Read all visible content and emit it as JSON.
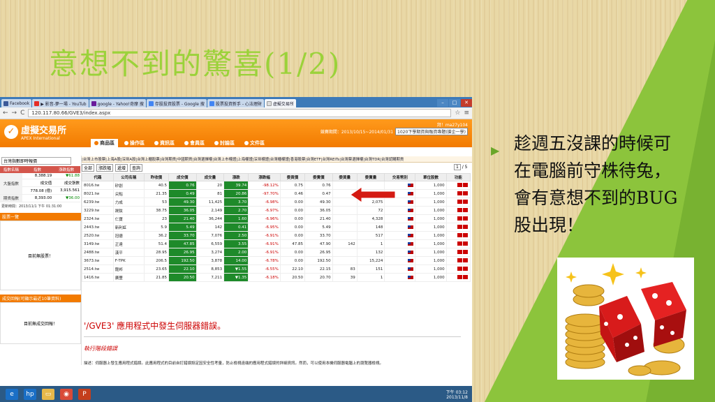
{
  "slide": {
    "title": "意想不到的驚喜(1/2)",
    "bullet": "趁週五沒課的時候可在電腦前守株待兔，會有意想不到的BUG股出現！"
  },
  "browser": {
    "tabs": [
      "Facebook",
      "▶ 影音-夢一場 - YouTub",
      "google - Yahoo!奇摩 搜",
      "存股投資股票 - Google 搜",
      "股票投資新手 - 心法理財",
      "虛擬交易所"
    ],
    "url": "120.117.80.66/GVE3/index.aspx"
  },
  "app": {
    "name": "虛擬交易所",
    "name_en": "APEX International",
    "user": "拜！ma27y104",
    "period": "競賽期間：2013/10/15~2014/01/31",
    "contest": "1020下學期資與融資專題(搶企一學)",
    "nav": [
      "商品區",
      "操作區",
      "資訊區",
      "會員區",
      "討論區",
      "文件區"
    ],
    "subnav": "|台灣上市股票|上海A股|深圳A股|台灣上櫃股票|台灣期貨|中國期貨|台灣選擇權|台灣上市權證|上海權證|深圳權證|台灣櫃權證|香港股票|台灣ETF|台灣REITs|台灣票選擇權|台灣TDR|台灣認購期貨"
  },
  "left": {
    "select": "台灣指數即時報價",
    "headers": [
      "指數名稱",
      "指數",
      "漲跌指數"
    ],
    "rows": [
      {
        "name": "大盤指數",
        "v1": "8,388.19",
        "v2": "▼61.88",
        "v3": "成交值",
        "v4": "成交張數",
        "v5": "778.08 (億)",
        "v6": "3,915.561"
      },
      {
        "name": "期貨指數",
        "v1": "8,393.00",
        "v2": "▼36.00"
      }
    ],
    "updated": "更新時間：2013/11/1 下午 01:31:00",
    "panel1": "股票一覽",
    "panel1_body": "目前無股票！",
    "panel2": "成交回報(可顯示最近10筆資料)",
    "panel2_body": "目前無成交回報！"
  },
  "tools": {
    "market": "全部",
    "sort": "漲跌幅",
    "order": "遞增",
    "query": "查詢",
    "page": "1",
    "pages": "5"
  },
  "grid": {
    "headers": [
      "代碼",
      "公司名稱",
      "昨收價",
      "成交價",
      "成交量",
      "漲跌",
      "漲跌幅",
      "委買價",
      "委賣價",
      "委買量",
      "委賣量",
      "交易幣別",
      "單位股數",
      "功能"
    ],
    "rows": [
      [
        "8016.tw",
        "矽創",
        "40.5",
        "0.76",
        "20",
        "39.74",
        "-98.12%",
        "0.75",
        "0.76",
        "",
        "",
        "",
        "1,000"
      ],
      [
        "8021.tw",
        "尖點",
        "21.35",
        "0.49",
        "81",
        "20.86",
        "-97.70%",
        "0.46",
        "0.47",
        "",
        "",
        "",
        "1,000"
      ],
      [
        "6239.tw",
        "力成",
        "53",
        "49.30",
        "11,425",
        "3.70",
        "-6.98%",
        "0.00",
        "49.30",
        "",
        "2,075",
        "",
        "1,000"
      ],
      [
        "3229.tw",
        "晟鈦",
        "38.75",
        "36.05",
        "2,149",
        "2.70",
        "-6.97%",
        "0.00",
        "36.05",
        "",
        "72",
        "",
        "1,000"
      ],
      [
        "2324.tw",
        "仁寶",
        "23",
        "21.40",
        "36,244",
        "1.60",
        "-6.96%",
        "0.00",
        "21.40",
        "",
        "4,328",
        "",
        "1,000"
      ],
      [
        "2443.tw",
        "新利虹",
        "5.9",
        "5.49",
        "142",
        "0.41",
        "-6.95%",
        "0.00",
        "5.49",
        "",
        "148",
        "",
        "1,000"
      ],
      [
        "2520.tw",
        "冠德",
        "36.2",
        "33.70",
        "7,076",
        "2.50",
        "-6.91%",
        "0.00",
        "33.70",
        "",
        "517",
        "",
        "1,000"
      ],
      [
        "3149.tw",
        "正達",
        "51.4",
        "47.85",
        "6,559",
        "3.55",
        "-6.91%",
        "47.85",
        "47.90",
        "142",
        "1",
        "",
        "1,000"
      ],
      [
        "2488.tw",
        "漢平",
        "28.95",
        "26.95",
        "3,274",
        "2.00",
        "-6.91%",
        "0.00",
        "26.95",
        "",
        "132",
        "",
        "1,000"
      ],
      [
        "3673.tw",
        "F-TPK",
        "206.5",
        "192.50",
        "3,878",
        "14.00",
        "-6.78%",
        "0.00",
        "192.50",
        "",
        "15,224",
        "",
        "1,000"
      ],
      [
        "2514.tw",
        "龍邦",
        "23.65",
        "22.10",
        "8,853",
        "▼1.55",
        "-6.55%",
        "22.10",
        "22.15",
        "83",
        "151",
        "",
        "1,000"
      ],
      [
        "1416.tw",
        "廣豐",
        "21.85",
        "20.50",
        "7,211",
        "▼1.35",
        "-6.18%",
        "20.50",
        "20.70",
        "39",
        "1",
        "",
        "1,000"
      ]
    ]
  },
  "error": {
    "title": "'/GVE3' 應用程式中發生伺服器錯誤。",
    "sub": "執行階段錯誤",
    "desc": "描述：伺服器上發生應用程式錯誤。此應用程式的目前自訂錯誤設定因安全性考量，防止檢視遠端的應用程式錯誤的詳細資訊。然而，可以使用本機伺服器電腦上的瀏覽器檢視。"
  },
  "taskbar": {
    "time": "下午 03:12",
    "date": "2013/11/8"
  },
  "colors": {
    "orange": "#f27a00",
    "green_accent": "#8cc43c",
    "up_red": "#cc0000",
    "volume_green": "#1e8a2a"
  }
}
